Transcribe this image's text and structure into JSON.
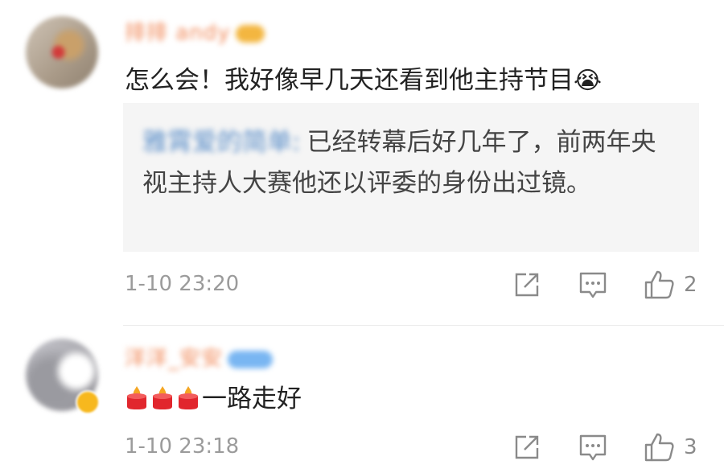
{
  "comments": [
    {
      "username": "排排 andy",
      "text": "怎么会！我好像早几天还看到他主持节目",
      "text_emoji": "😭",
      "reply": {
        "username": "雅霄爱的简单:",
        "text": "已经转幕后好几年了，前两年央视主持人大赛他还以评委的身份出过镜。"
      },
      "time": "1-10 23:20",
      "likes": "2"
    },
    {
      "username": "洋洋_安安",
      "text": "一路走好",
      "candles": 3,
      "time": "1-10 23:18",
      "likes": "3"
    }
  ],
  "icons": {
    "share": "share-icon",
    "comment": "comment-icon",
    "like": "like-icon",
    "candle": "candle-emoji",
    "crying": "crying-emoji"
  },
  "colors": {
    "username": "#f18a5a",
    "reply_user": "#5c8fc9",
    "meta": "#9b9b9b",
    "reply_bg": "#f5f5f5"
  }
}
